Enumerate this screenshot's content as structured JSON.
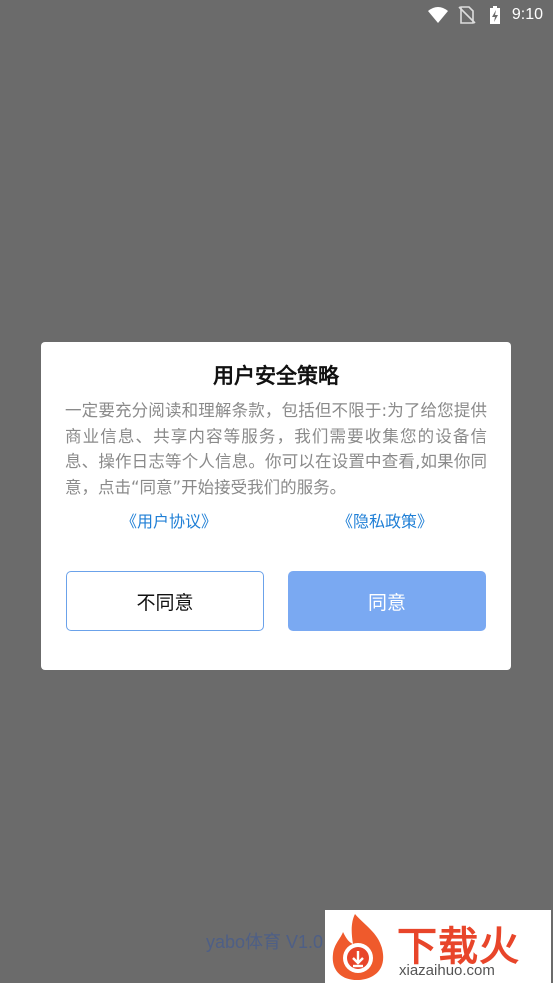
{
  "status_bar": {
    "time": "9:10",
    "icons": [
      "wifi-icon",
      "no-sim-icon",
      "battery-charging-icon"
    ]
  },
  "dialog": {
    "title": "用户安全策略",
    "body": "一定要充分阅读和理解条款，包括但不限于:为了给您提供商业信息、共享内容等服务，我们需要收集您的设备信息、操作日志等个人信息。你可以在设置中查看,如果你同意，点击“同意”开始接受我们的服务。",
    "link_user_agreement": "《用户协议》",
    "link_privacy_policy": "《隐私政策》",
    "disagree_label": "不同意",
    "agree_label": "同意"
  },
  "footer": {
    "version": "yabo体育 V1.0"
  },
  "watermark": {
    "brand_cn": "下载火",
    "brand_en": "xiazaihuo.com"
  },
  "colors": {
    "overlay": "#6b6b6b",
    "link": "#1f7fd6",
    "agree_button": "#7aa9f2",
    "brand": "#e8452a"
  }
}
